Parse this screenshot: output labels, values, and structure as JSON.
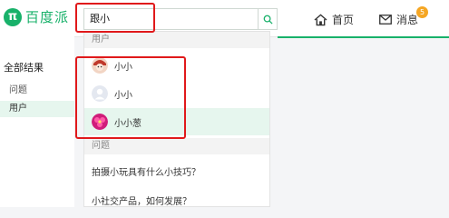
{
  "header": {
    "logo_text": "百度派",
    "search_value": "跟小",
    "nav_home": "首页",
    "nav_messages": "消息",
    "message_badge": "5"
  },
  "sidebar": {
    "title": "全部结果",
    "items": [
      {
        "label": "问题"
      },
      {
        "label": "用户"
      }
    ]
  },
  "dropdown": {
    "users_header": "用户",
    "users": [
      {
        "name": "小小"
      },
      {
        "name": "小小"
      },
      {
        "name": "小小葱"
      }
    ],
    "questions_header": "问题",
    "questions": [
      {
        "text": "拍摄小玩具有什么小技巧？"
      },
      {
        "text": "小社交产品，如何发展？"
      }
    ]
  },
  "colors": {
    "brand": "#18b16a",
    "highlight": "#e6f6ee",
    "annotation": "#e0191b",
    "badge": "#f5a623"
  }
}
